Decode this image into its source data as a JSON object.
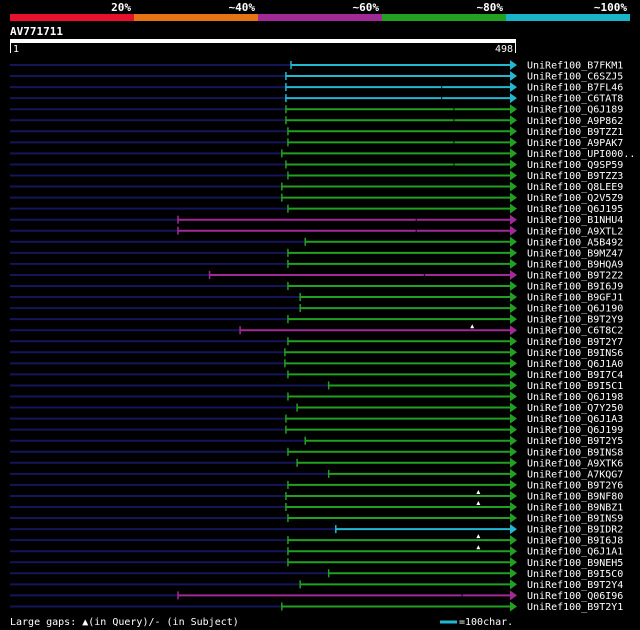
{
  "chart_data": {
    "type": "bar",
    "title": "AV771711",
    "query_length": 498,
    "ruler": {
      "start_label": "1",
      "end_label": "498",
      "start": 1,
      "end": 498
    },
    "identity_scale": {
      "labels": [
        "20%",
        "~40%",
        "~60%",
        "~80%",
        "~100%"
      ],
      "colors": [
        "#e8112d",
        "#e67314",
        "#a02a96",
        "#22a022",
        "#18b4c8"
      ]
    },
    "legend": {
      "gaps_text": "Large gaps: ▲(in Query)/- (in Subject)",
      "scale_text": "=100char.",
      "scale_color": "#22b8d2"
    },
    "colors": {
      "background": "#000000",
      "text": "#ffffff",
      "ruler_fill": "#ffffff",
      "unaligned": "#15155a",
      "band_cyan": "#22b8d2",
      "band_green": "#22a022",
      "band_purple": "#a02a96"
    },
    "hits": [
      {
        "name": "UniRef100_B7FKM1",
        "start": 277,
        "end": 498,
        "band": "cyan",
        "gaps": [],
        "ticks": []
      },
      {
        "name": "UniRef100_C6SZJ5",
        "start": 272,
        "end": 498,
        "band": "cyan",
        "gaps": [],
        "ticks": []
      },
      {
        "name": "UniRef100_B7FL46",
        "start": 272,
        "end": 498,
        "band": "cyan",
        "gaps": [],
        "ticks": [
          425
        ]
      },
      {
        "name": "UniRef100_C6TAT8",
        "start": 272,
        "end": 498,
        "band": "cyan",
        "gaps": [],
        "ticks": [
          425
        ]
      },
      {
        "name": "UniRef100_Q6J189",
        "start": 272,
        "end": 498,
        "band": "green",
        "gaps": [],
        "ticks": [
          437
        ]
      },
      {
        "name": "UniRef100_A9P862",
        "start": 272,
        "end": 498,
        "band": "green",
        "gaps": [],
        "ticks": [
          437
        ]
      },
      {
        "name": "UniRef100_B9TZZ1",
        "start": 274,
        "end": 498,
        "band": "green",
        "gaps": [],
        "ticks": []
      },
      {
        "name": "UniRef100_A9PAK7",
        "start": 274,
        "end": 498,
        "band": "green",
        "gaps": [],
        "ticks": [
          437
        ]
      },
      {
        "name": "UniRef100_UPI000..",
        "start": 268,
        "end": 498,
        "band": "green",
        "gaps": [],
        "ticks": []
      },
      {
        "name": "UniRef100_Q9SP59",
        "start": 272,
        "end": 498,
        "band": "green",
        "gaps": [],
        "ticks": [
          437
        ]
      },
      {
        "name": "UniRef100_B9TZZ3",
        "start": 274,
        "end": 498,
        "band": "green",
        "gaps": [],
        "ticks": []
      },
      {
        "name": "UniRef100_Q8LEE9",
        "start": 268,
        "end": 498,
        "band": "green",
        "gaps": [],
        "ticks": []
      },
      {
        "name": "UniRef100_Q2V5Z9",
        "start": 268,
        "end": 498,
        "band": "green",
        "gaps": [],
        "ticks": []
      },
      {
        "name": "UniRef100_Q6J195",
        "start": 274,
        "end": 498,
        "band": "green",
        "gaps": [],
        "ticks": []
      },
      {
        "name": "UniRef100_B1NHU4",
        "start": 166,
        "end": 498,
        "band": "purple",
        "gaps": [],
        "ticks": [
          400
        ]
      },
      {
        "name": "UniRef100_A9XTL2",
        "start": 166,
        "end": 498,
        "band": "purple",
        "gaps": [],
        "ticks": [
          400
        ]
      },
      {
        "name": "UniRef100_A5B492",
        "start": 291,
        "end": 498,
        "band": "green",
        "gaps": [],
        "ticks": []
      },
      {
        "name": "UniRef100_B9MZ47",
        "start": 274,
        "end": 498,
        "band": "green",
        "gaps": [],
        "ticks": []
      },
      {
        "name": "UniRef100_B9HQA9",
        "start": 274,
        "end": 498,
        "band": "green",
        "gaps": [],
        "ticks": []
      },
      {
        "name": "UniRef100_B9T2Z2",
        "start": 197,
        "end": 498,
        "band": "purple",
        "gaps": [],
        "ticks": [
          408
        ]
      },
      {
        "name": "UniRef100_B9I6J9",
        "start": 274,
        "end": 498,
        "band": "green",
        "gaps": [],
        "ticks": []
      },
      {
        "name": "UniRef100_B9GFJ1",
        "start": 286,
        "end": 498,
        "band": "green",
        "gaps": [],
        "ticks": []
      },
      {
        "name": "UniRef100_Q6J190",
        "start": 286,
        "end": 498,
        "band": "green",
        "gaps": [],
        "ticks": []
      },
      {
        "name": "UniRef100_B9T2Y9",
        "start": 274,
        "end": 498,
        "band": "green",
        "gaps": [],
        "ticks": []
      },
      {
        "name": "UniRef100_C6T8C2",
        "start": 227,
        "end": 498,
        "band": "purple",
        "gaps": [
          455
        ],
        "ticks": []
      },
      {
        "name": "UniRef100_B9T2Y7",
        "start": 274,
        "end": 498,
        "band": "green",
        "gaps": [],
        "ticks": []
      },
      {
        "name": "UniRef100_B9INS6",
        "start": 271,
        "end": 498,
        "band": "green",
        "gaps": [],
        "ticks": []
      },
      {
        "name": "UniRef100_Q6J1A0",
        "start": 271,
        "end": 498,
        "band": "green",
        "gaps": [],
        "ticks": []
      },
      {
        "name": "UniRef100_B9I7C4",
        "start": 274,
        "end": 498,
        "band": "green",
        "gaps": [],
        "ticks": []
      },
      {
        "name": "UniRef100_B9I5C1",
        "start": 314,
        "end": 498,
        "band": "green",
        "gaps": [],
        "ticks": []
      },
      {
        "name": "UniRef100_Q6J198",
        "start": 274,
        "end": 498,
        "band": "green",
        "gaps": [],
        "ticks": []
      },
      {
        "name": "UniRef100_Q7Y250",
        "start": 283,
        "end": 498,
        "band": "green",
        "gaps": [],
        "ticks": []
      },
      {
        "name": "UniRef100_Q6J1A3",
        "start": 272,
        "end": 498,
        "band": "green",
        "gaps": [],
        "ticks": []
      },
      {
        "name": "UniRef100_Q6J199",
        "start": 272,
        "end": 498,
        "band": "green",
        "gaps": [],
        "ticks": []
      },
      {
        "name": "UniRef100_B9T2Y5",
        "start": 291,
        "end": 498,
        "band": "green",
        "gaps": [],
        "ticks": []
      },
      {
        "name": "UniRef100_B9INS8",
        "start": 274,
        "end": 498,
        "band": "green",
        "gaps": [],
        "ticks": []
      },
      {
        "name": "UniRef100_A9XTK6",
        "start": 283,
        "end": 498,
        "band": "green",
        "gaps": [],
        "ticks": []
      },
      {
        "name": "UniRef100_A7KQG7",
        "start": 314,
        "end": 498,
        "band": "green",
        "gaps": [],
        "ticks": []
      },
      {
        "name": "UniRef100_B9T2Y6",
        "start": 274,
        "end": 498,
        "band": "green",
        "gaps": [],
        "ticks": []
      },
      {
        "name": "UniRef100_B9NF80",
        "start": 272,
        "end": 498,
        "band": "green",
        "gaps": [
          461
        ],
        "ticks": []
      },
      {
        "name": "UniRef100_B9NBZ1",
        "start": 272,
        "end": 498,
        "band": "green",
        "gaps": [
          461
        ],
        "ticks": []
      },
      {
        "name": "UniRef100_B9INS9",
        "start": 274,
        "end": 498,
        "band": "green",
        "gaps": [],
        "ticks": []
      },
      {
        "name": "UniRef100_B9IDR2",
        "start": 321,
        "end": 498,
        "band": "cyan",
        "gaps": [],
        "ticks": []
      },
      {
        "name": "UniRef100_B9I6J8",
        "start": 274,
        "end": 498,
        "band": "green",
        "gaps": [
          461
        ],
        "ticks": []
      },
      {
        "name": "UniRef100_Q6J1A1",
        "start": 274,
        "end": 498,
        "band": "green",
        "gaps": [
          461
        ],
        "ticks": []
      },
      {
        "name": "UniRef100_B9NEH5",
        "start": 274,
        "end": 498,
        "band": "green",
        "gaps": [],
        "ticks": []
      },
      {
        "name": "UniRef100_B9I5C0",
        "start": 314,
        "end": 498,
        "band": "green",
        "gaps": [],
        "ticks": []
      },
      {
        "name": "UniRef100_B9T2Y4",
        "start": 286,
        "end": 498,
        "band": "green",
        "gaps": [],
        "ticks": []
      },
      {
        "name": "UniRef100_Q06I96",
        "start": 166,
        "end": 498,
        "band": "purple",
        "gaps": [],
        "ticks": [
          445
        ]
      },
      {
        "name": "UniRef100_B9T2Y1",
        "start": 268,
        "end": 498,
        "band": "green",
        "gaps": [],
        "ticks": []
      }
    ]
  }
}
